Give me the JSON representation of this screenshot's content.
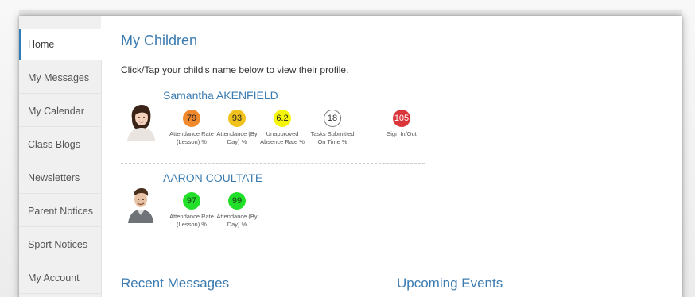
{
  "sidebar": {
    "items": [
      {
        "label": "Home"
      },
      {
        "label": "My Messages"
      },
      {
        "label": "My Calendar"
      },
      {
        "label": "Class Blogs"
      },
      {
        "label": "Newsletters"
      },
      {
        "label": "Parent Notices"
      },
      {
        "label": "Sport Notices"
      },
      {
        "label": "My Account"
      }
    ],
    "active": "Home"
  },
  "main": {
    "title": "My Children",
    "instruction": "Click/Tap your child's name below to view their profile.",
    "children": [
      {
        "name": "Samantha AKENFIELD",
        "avatar": "girl-avatar-icon",
        "stats": [
          {
            "value": "79",
            "label": "Attendance Rate (Lesson) %",
            "color": "#f0882c"
          },
          {
            "value": "93",
            "label": "Attendance (By Day) %",
            "color": "#f1c21b"
          },
          {
            "value": "6.2",
            "label": "Unapproved Absence Rate %",
            "color": "#f5f50a"
          },
          {
            "value": "18",
            "label": "Tasks Submitted On Time %",
            "color": "#ffffff"
          },
          {
            "value": "105",
            "label": "Sign In/Out",
            "color": "#d9353b"
          }
        ]
      },
      {
        "name": "AARON COULTATE",
        "avatar": "boy-avatar-icon",
        "stats": [
          {
            "value": "97",
            "label": "Attendance Rate (Lesson) %",
            "color": "#22e02a"
          },
          {
            "value": "99",
            "label": "Attendance (By Day) %",
            "color": "#22e02a"
          }
        ]
      }
    ],
    "recent_messages_title": "Recent Messages",
    "upcoming_events_title": "Upcoming Events"
  },
  "colors": {
    "accent": "#3b7bb0",
    "sidebar_bg": "#f0f0f0",
    "active_marker": "#2f7db8"
  }
}
